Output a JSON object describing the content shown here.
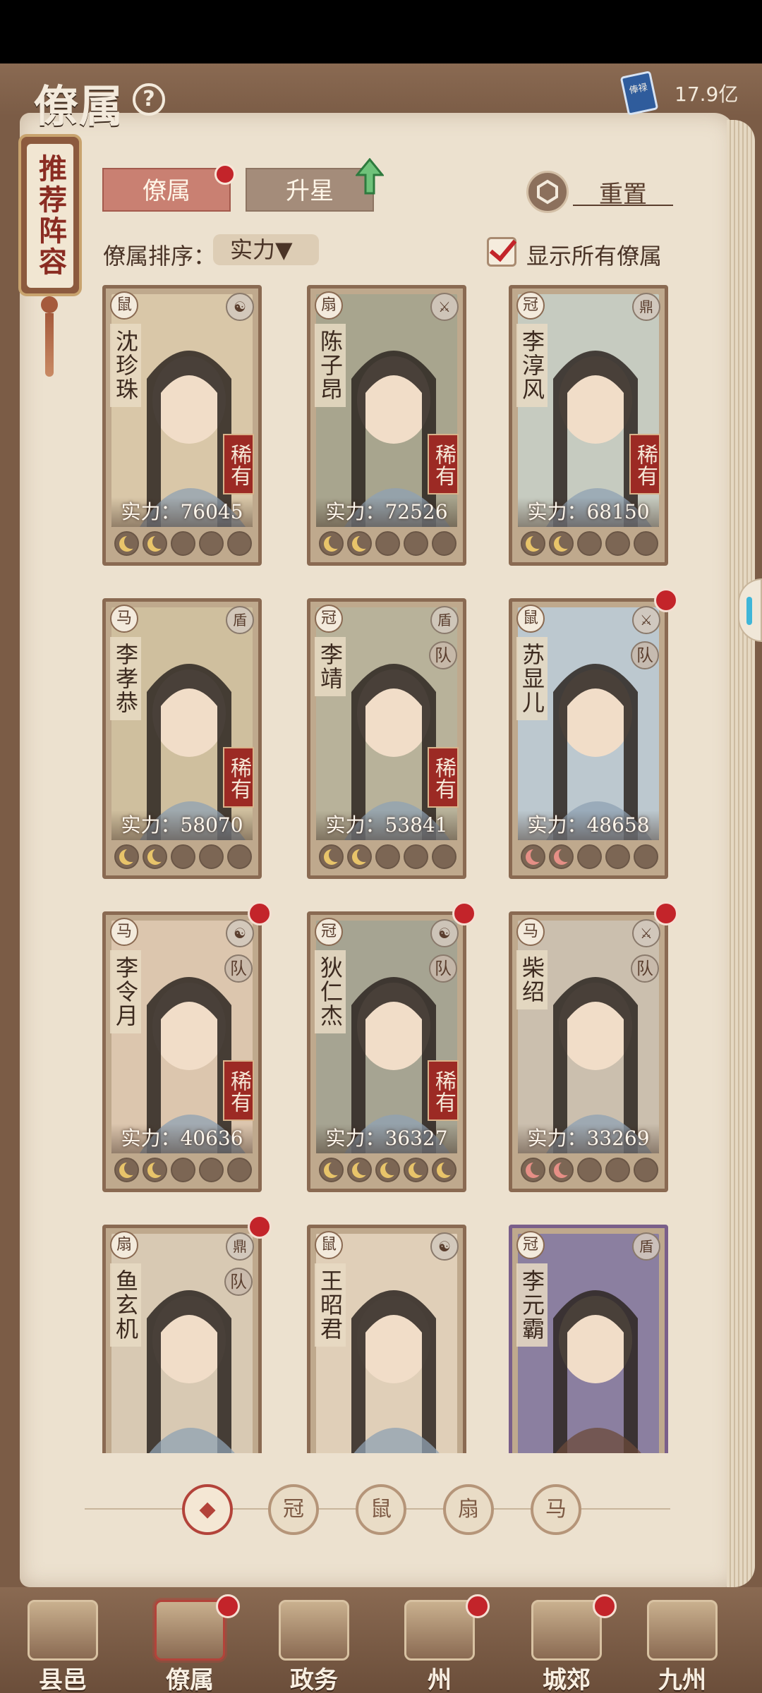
{
  "header": {
    "title": "僚属",
    "help": "?",
    "currency_value": "17.9亿",
    "currency_icon": "book-currency-icon",
    "currency_icon_text": "俸禄"
  },
  "banner": {
    "label": "推荐阵容"
  },
  "tabs": [
    {
      "label": "僚属",
      "active": true,
      "badge": true
    },
    {
      "label": "升星",
      "active": false,
      "arrow": "up"
    }
  ],
  "reset": {
    "label": "重置"
  },
  "sort": {
    "label": "僚属排序：",
    "value": "实力▼"
  },
  "show_all": {
    "label": "显示所有僚属",
    "checked": true
  },
  "rarity_label": "稀有",
  "team_label": "队",
  "cards": [
    {
      "name": "沈珍珠",
      "power": "实力：76045",
      "rare": true,
      "team": false,
      "type_icon": "rat-icon",
      "skill_icon": "taiji-icon",
      "stars": [
        "gold",
        "gold",
        "empty",
        "empty",
        "empty"
      ],
      "dot": false,
      "bg": "#d9c7a8"
    },
    {
      "name": "陈子昂",
      "power": "实力：72526",
      "rare": true,
      "team": false,
      "type_icon": "fan-icon",
      "skill_icon": "sword-icon",
      "stars": [
        "gold",
        "gold",
        "empty",
        "empty",
        "empty"
      ],
      "dot": false,
      "bg": "#a8a58e"
    },
    {
      "name": "李淳风",
      "power": "实力：68150",
      "rare": true,
      "team": false,
      "type_icon": "hat-icon",
      "skill_icon": "tripod-icon",
      "stars": [
        "gold",
        "gold",
        "empty",
        "empty",
        "empty"
      ],
      "dot": false,
      "bg": "#c6cbc0"
    },
    {
      "name": "李孝恭",
      "power": "实力：58070",
      "rare": true,
      "team": false,
      "type_icon": "horse-icon",
      "skill_icon": "shield-icon",
      "stars": [
        "gold",
        "gold",
        "empty",
        "empty",
        "empty"
      ],
      "dot": false,
      "bg": "#cfbf9e"
    },
    {
      "name": "李靖",
      "power": "实力：53841",
      "rare": true,
      "team": true,
      "type_icon": "hat-icon",
      "skill_icon": "shield-icon",
      "stars": [
        "gold",
        "gold",
        "empty",
        "empty",
        "empty"
      ],
      "dot": false,
      "bg": "#b8b29a"
    },
    {
      "name": "苏显儿",
      "power": "实力：48658",
      "rare": false,
      "team": true,
      "type_icon": "rat-icon",
      "skill_icon": "sword-icon",
      "stars": [
        "red",
        "red",
        "empty",
        "empty",
        "empty"
      ],
      "dot": true,
      "bg": "#bcc8cf"
    },
    {
      "name": "李令月",
      "power": "实力：40636",
      "rare": true,
      "team": true,
      "type_icon": "horse-icon",
      "skill_icon": "taiji-icon",
      "stars": [
        "gold",
        "gold",
        "empty",
        "empty",
        "empty"
      ],
      "dot": true,
      "bg": "#dcc6ae"
    },
    {
      "name": "狄仁杰",
      "power": "实力：36327",
      "rare": true,
      "team": true,
      "type_icon": "hat-icon",
      "skill_icon": "taiji-icon",
      "stars": [
        "gold",
        "gold",
        "gold",
        "gold",
        "gold"
      ],
      "dot": true,
      "bg": "#a6a492"
    },
    {
      "name": "柴绍",
      "power": "实力：33269",
      "rare": false,
      "team": true,
      "type_icon": "horse-icon",
      "skill_icon": "sword-icon",
      "stars": [
        "red",
        "red",
        "empty",
        "empty",
        "empty"
      ],
      "dot": true,
      "bg": "#cbbfae"
    },
    {
      "name": "鱼玄机",
      "power": "",
      "rare": false,
      "team": true,
      "type_icon": "fan-icon",
      "skill_icon": "tripod-icon",
      "stars": [],
      "dot": true,
      "bg": "#d8c9b3"
    },
    {
      "name": "王昭君",
      "power": "",
      "rare": false,
      "team": false,
      "type_icon": "rat-icon",
      "skill_icon": "taiji-icon",
      "stars": [],
      "dot": false,
      "bg": "#e0cfb8"
    },
    {
      "name": "李元霸",
      "power": "",
      "rare": false,
      "team": false,
      "type_icon": "hat-icon",
      "skill_icon": "shield-icon",
      "stars": [],
      "dot": false,
      "bg": "#8b7fa0"
    }
  ],
  "filters": [
    {
      "icon": "all-icon",
      "glyph": "◆",
      "active": true
    },
    {
      "icon": "hat-icon",
      "glyph": "冠",
      "active": false
    },
    {
      "icon": "rat-icon",
      "glyph": "鼠",
      "active": false
    },
    {
      "icon": "fan-icon",
      "glyph": "扇",
      "active": false
    },
    {
      "icon": "horse-icon",
      "glyph": "马",
      "active": false
    }
  ],
  "nav": [
    {
      "label": "县邑",
      "icon": "town-icon",
      "active": false,
      "dot": false
    },
    {
      "label": "僚属",
      "icon": "retainer-icon",
      "active": true,
      "dot": true
    },
    {
      "label": "政务",
      "icon": "affairs-icon",
      "active": false,
      "dot": false
    },
    {
      "label": "州",
      "icon": "state-icon",
      "active": false,
      "dot": true
    },
    {
      "label": "城郊",
      "icon": "suburb-icon",
      "active": false,
      "dot": true
    },
    {
      "label": "九州",
      "icon": "map-icon",
      "active": false,
      "dot": false
    }
  ],
  "colors": {
    "accent_red": "#c3242a",
    "rarity_red": "#9c2a24",
    "page": "#ece1cf",
    "frame": "#7b5c46"
  }
}
